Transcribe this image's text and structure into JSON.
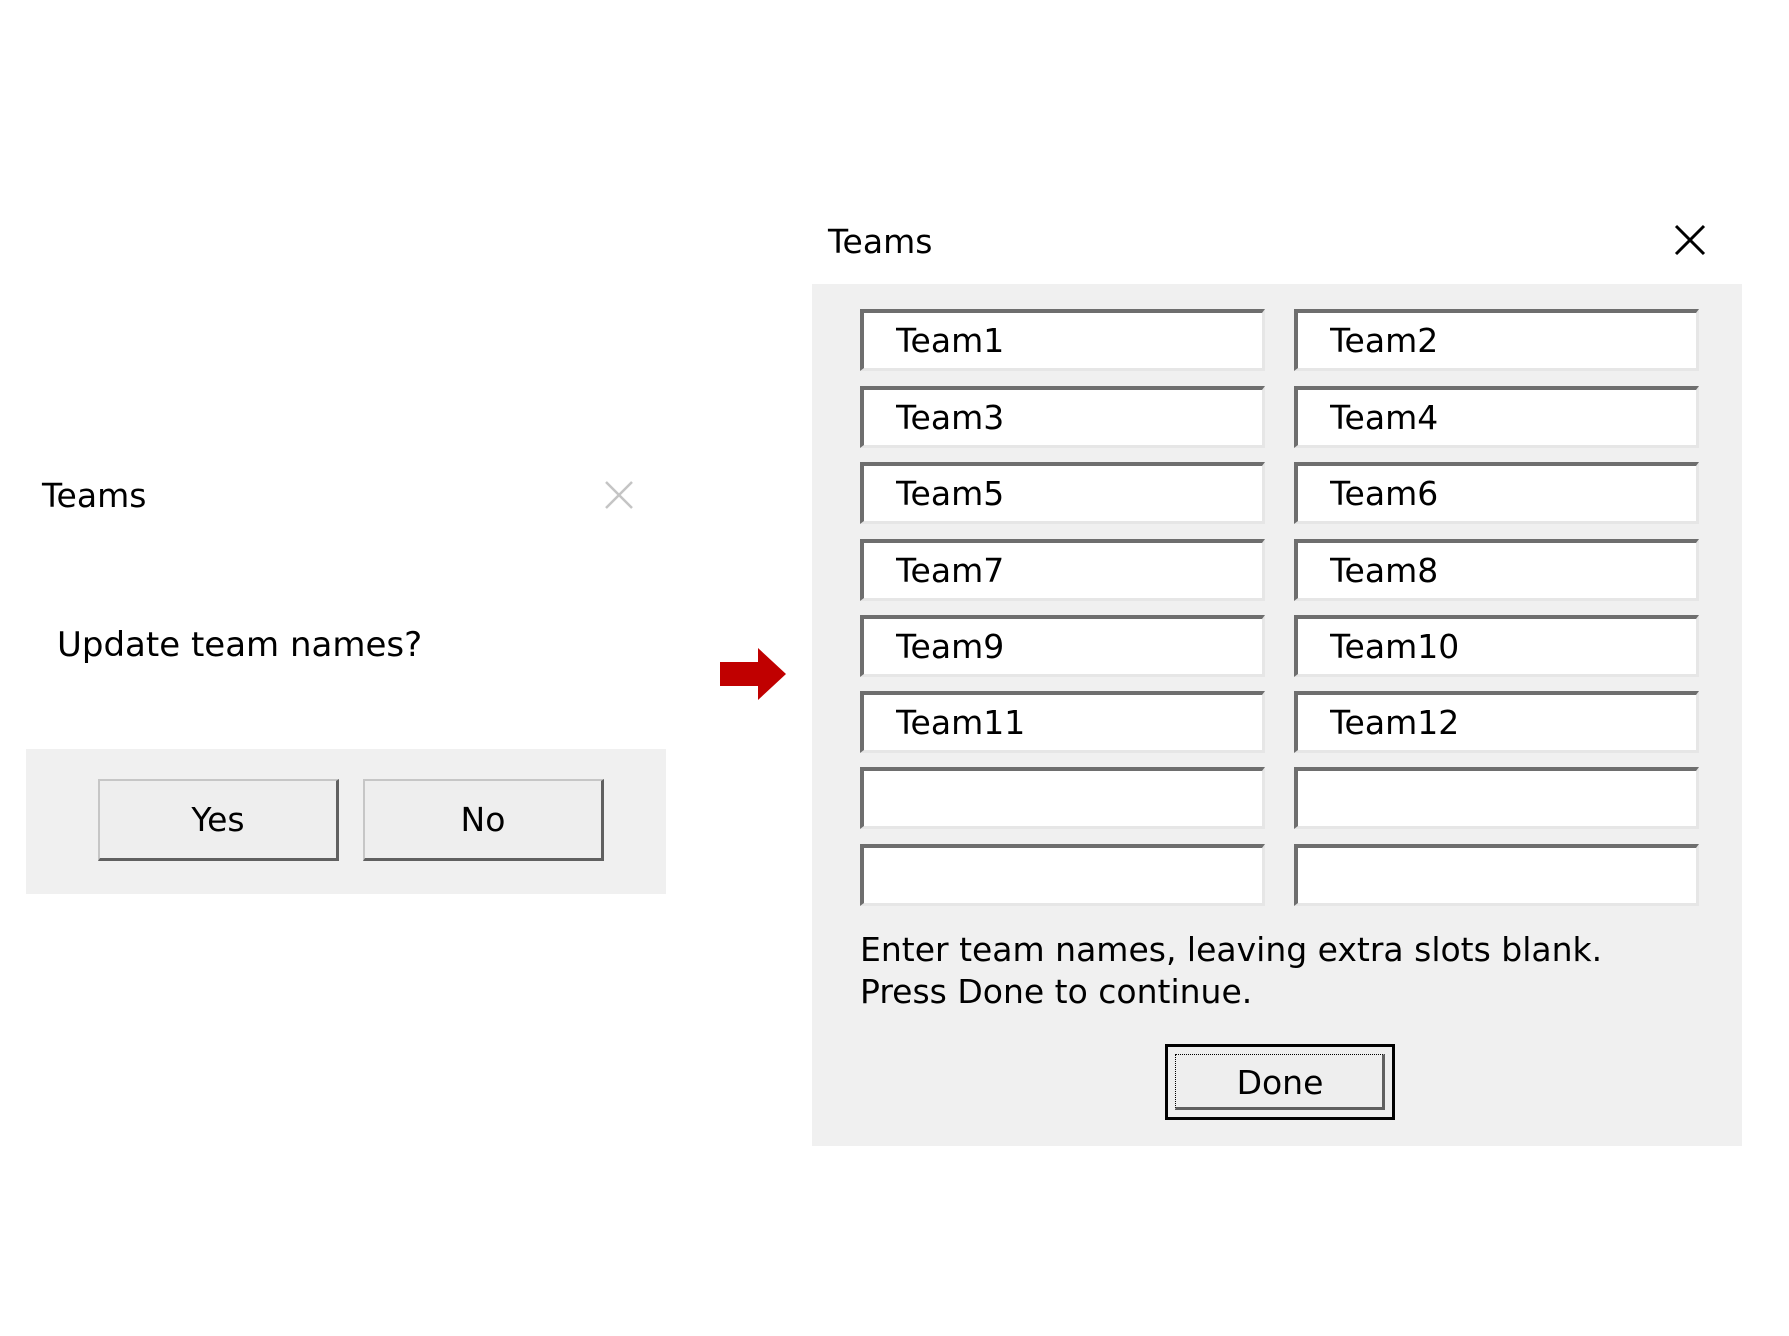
{
  "confirm_dialog": {
    "title": "Teams",
    "close_icon": "close-icon",
    "message": "Update team names?",
    "yes_label": "Yes",
    "no_label": "No"
  },
  "arrow": {
    "icon": "right-arrow-icon",
    "color": "#c00000"
  },
  "teams_dialog": {
    "title": "Teams",
    "close_icon": "close-icon",
    "fields": [
      "Team1",
      "Team2",
      "Team3",
      "Team4",
      "Team5",
      "Team6",
      "Team7",
      "Team8",
      "Team9",
      "Team10",
      "Team11",
      "Team12",
      "",
      "",
      "",
      ""
    ],
    "instructions": "Enter team names, leaving extra slots blank. Press Done to continue.",
    "done_label": "Done"
  }
}
